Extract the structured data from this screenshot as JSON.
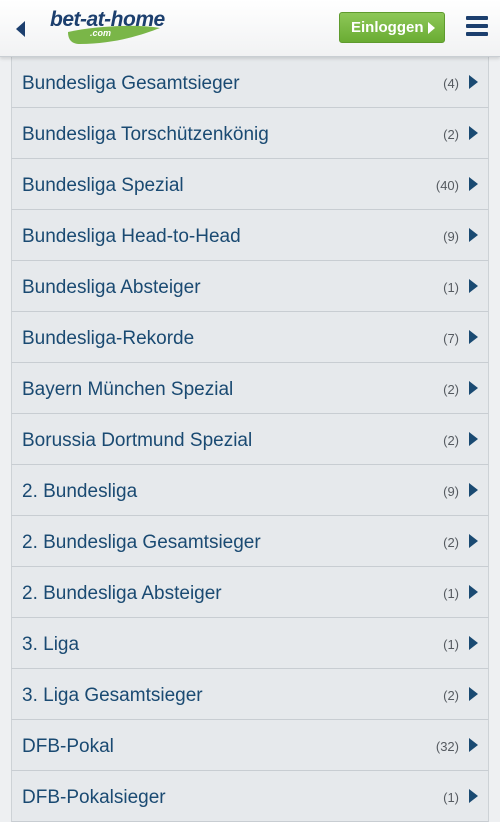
{
  "header": {
    "logo_text": "bet-at-home",
    "logo_sub": ".com",
    "login_label": "Einloggen"
  },
  "items": [
    {
      "label": "Bundesliga Gesamtsieger",
      "count": "(4)"
    },
    {
      "label": "Bundesliga Torschützenkönig",
      "count": "(2)"
    },
    {
      "label": "Bundesliga Spezial",
      "count": "(40)"
    },
    {
      "label": "Bundesliga Head-to-Head",
      "count": "(9)"
    },
    {
      "label": "Bundesliga Absteiger",
      "count": "(1)"
    },
    {
      "label": "Bundesliga-Rekorde",
      "count": "(7)"
    },
    {
      "label": "Bayern München Spezial",
      "count": "(2)"
    },
    {
      "label": "Borussia Dortmund Spezial",
      "count": "(2)"
    },
    {
      "label": "2. Bundesliga",
      "count": "(9)"
    },
    {
      "label": "2. Bundesliga Gesamtsieger",
      "count": "(2)"
    },
    {
      "label": "2. Bundesliga Absteiger",
      "count": "(1)"
    },
    {
      "label": "3. Liga",
      "count": "(1)"
    },
    {
      "label": "3. Liga Gesamtsieger",
      "count": "(2)"
    },
    {
      "label": "DFB-Pokal",
      "count": "(32)"
    },
    {
      "label": "DFB-Pokalsieger",
      "count": "(1)"
    }
  ]
}
